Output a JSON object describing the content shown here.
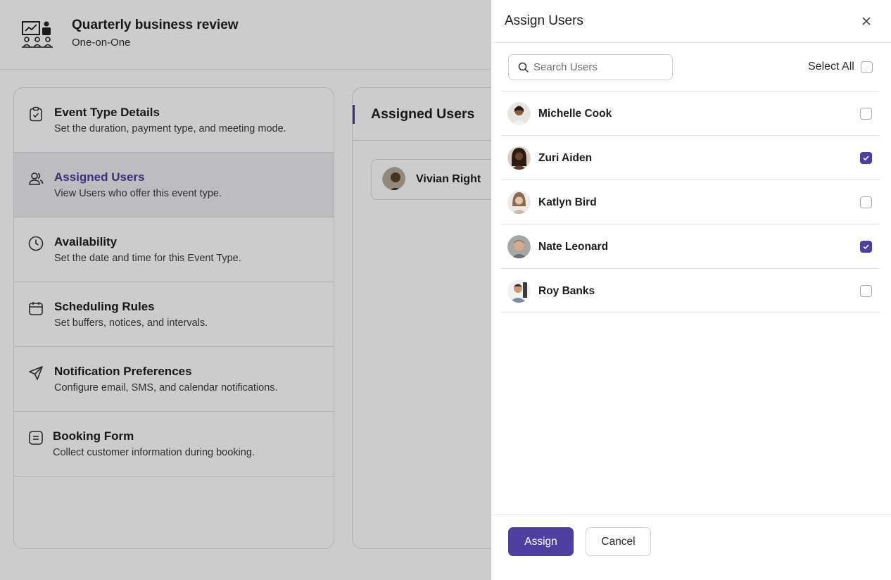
{
  "event": {
    "title": "Quarterly business review",
    "subtitle": "One-on-One",
    "icon": "presentation-meeting-icon"
  },
  "menu": [
    {
      "title": "Event Type Details",
      "desc": "Set the duration, payment type, and meeting mode.",
      "icon": "clipboard-check-icon",
      "active": false
    },
    {
      "title": "Assigned Users",
      "desc": "View Users who offer this event type.",
      "icon": "users-icon",
      "active": true
    },
    {
      "title": "Availability",
      "desc": "Set the date and time for this Event Type.",
      "icon": "clock-icon",
      "active": false
    },
    {
      "title": "Scheduling Rules",
      "desc": "Set buffers, notices, and intervals.",
      "icon": "calendar-icon",
      "active": false
    },
    {
      "title": "Notification Preferences",
      "desc": "Configure email, SMS, and calendar notifications.",
      "icon": "send-icon",
      "active": false
    },
    {
      "title": "Booking Form",
      "desc": "Collect customer information during booking.",
      "icon": "form-icon",
      "active": false
    }
  ],
  "detail": {
    "title": "Assigned Users",
    "assigned": [
      {
        "name": "Vivian Right"
      }
    ]
  },
  "drawer": {
    "title": "Assign Users",
    "search_placeholder": "Search Users",
    "search_value": "",
    "select_all_label": "Select All",
    "select_all_checked": false,
    "users": [
      {
        "name": "Michelle Cook",
        "checked": false
      },
      {
        "name": "Zuri Aiden",
        "checked": true
      },
      {
        "name": "Katlyn Bird",
        "checked": false
      },
      {
        "name": "Nate Leonard",
        "checked": true
      },
      {
        "name": "Roy Banks",
        "checked": false
      }
    ],
    "assign_label": "Assign",
    "cancel_label": "Cancel"
  },
  "colors": {
    "accent": "#4e3ea0",
    "overlay": "rgba(0,0,0,0.2)",
    "border": "#dcdce0"
  }
}
